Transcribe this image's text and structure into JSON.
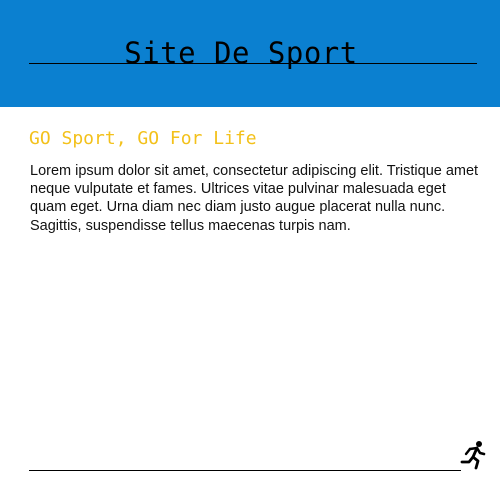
{
  "header": {
    "title": "Site De Sport",
    "background_color": "#0b80d0"
  },
  "main": {
    "slogan": "GO Sport, GO For Life",
    "slogan_color": "#f3c11b",
    "paragraph": "Lorem ipsum dolor sit amet, consectetur adipiscing elit. Tristique amet neque vulputate et fames. Ultrices vitae pulvinar malesuada eget quam eget. Urna diam nec diam justo augue placerat nulla nunc. Sagittis, suspendisse tellus maecenas turpis nam."
  },
  "footer": {
    "icon": "runner-icon"
  }
}
